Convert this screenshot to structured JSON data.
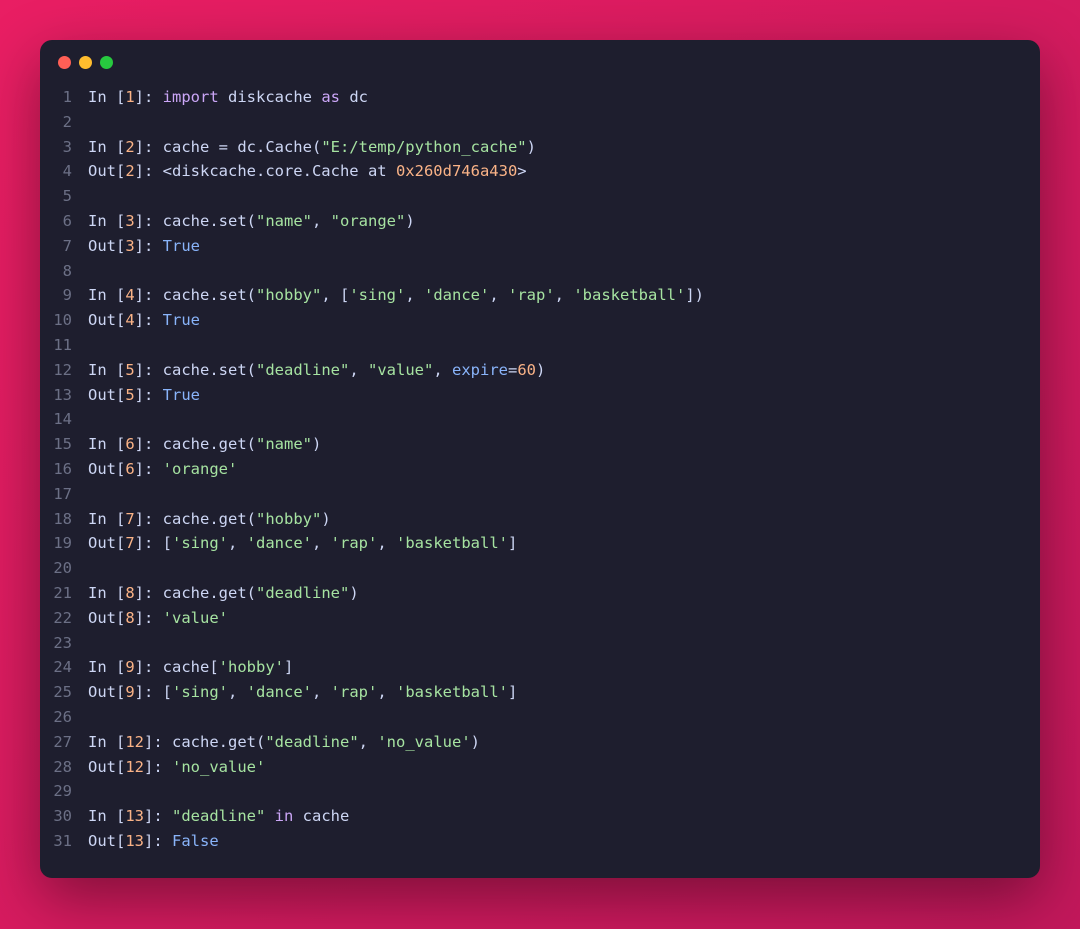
{
  "window": {
    "dots": [
      "red",
      "yellow",
      "green"
    ]
  },
  "lines": [
    {
      "n": "1",
      "tokens": [
        {
          "c": "t-default",
          "t": "In ["
        },
        {
          "c": "t-number",
          "t": "1"
        },
        {
          "c": "t-default",
          "t": "]: "
        },
        {
          "c": "t-keyword",
          "t": "import"
        },
        {
          "c": "t-default",
          "t": " diskcache "
        },
        {
          "c": "t-keyword",
          "t": "as"
        },
        {
          "c": "t-default",
          "t": " dc"
        }
      ]
    },
    {
      "n": "2",
      "tokens": []
    },
    {
      "n": "3",
      "tokens": [
        {
          "c": "t-default",
          "t": "In ["
        },
        {
          "c": "t-number",
          "t": "2"
        },
        {
          "c": "t-default",
          "t": "]: cache = dc.Cache("
        },
        {
          "c": "t-string",
          "t": "\"E:/temp/python_cache\""
        },
        {
          "c": "t-default",
          "t": ")"
        }
      ]
    },
    {
      "n": "4",
      "tokens": [
        {
          "c": "t-default",
          "t": "Out["
        },
        {
          "c": "t-number",
          "t": "2"
        },
        {
          "c": "t-default",
          "t": "]: <diskcache.core.Cache at "
        },
        {
          "c": "t-number",
          "t": "0x260d746a430"
        },
        {
          "c": "t-default",
          "t": ">"
        }
      ]
    },
    {
      "n": "5",
      "tokens": []
    },
    {
      "n": "6",
      "tokens": [
        {
          "c": "t-default",
          "t": "In ["
        },
        {
          "c": "t-number",
          "t": "3"
        },
        {
          "c": "t-default",
          "t": "]: cache.set("
        },
        {
          "c": "t-string",
          "t": "\"name\""
        },
        {
          "c": "t-default",
          "t": ", "
        },
        {
          "c": "t-string",
          "t": "\"orange\""
        },
        {
          "c": "t-default",
          "t": ")"
        }
      ]
    },
    {
      "n": "7",
      "tokens": [
        {
          "c": "t-default",
          "t": "Out["
        },
        {
          "c": "t-number",
          "t": "3"
        },
        {
          "c": "t-default",
          "t": "]: "
        },
        {
          "c": "t-bool",
          "t": "True"
        }
      ]
    },
    {
      "n": "8",
      "tokens": []
    },
    {
      "n": "9",
      "tokens": [
        {
          "c": "t-default",
          "t": "In ["
        },
        {
          "c": "t-number",
          "t": "4"
        },
        {
          "c": "t-default",
          "t": "]: cache.set("
        },
        {
          "c": "t-string",
          "t": "\"hobby\""
        },
        {
          "c": "t-default",
          "t": ", ["
        },
        {
          "c": "t-string",
          "t": "'sing'"
        },
        {
          "c": "t-default",
          "t": ", "
        },
        {
          "c": "t-string",
          "t": "'dance'"
        },
        {
          "c": "t-default",
          "t": ", "
        },
        {
          "c": "t-string",
          "t": "'rap'"
        },
        {
          "c": "t-default",
          "t": ", "
        },
        {
          "c": "t-string",
          "t": "'basketball'"
        },
        {
          "c": "t-default",
          "t": "])"
        }
      ]
    },
    {
      "n": "10",
      "tokens": [
        {
          "c": "t-default",
          "t": "Out["
        },
        {
          "c": "t-number",
          "t": "4"
        },
        {
          "c": "t-default",
          "t": "]: "
        },
        {
          "c": "t-bool",
          "t": "True"
        }
      ]
    },
    {
      "n": "11",
      "tokens": []
    },
    {
      "n": "12",
      "tokens": [
        {
          "c": "t-default",
          "t": "In ["
        },
        {
          "c": "t-number",
          "t": "5"
        },
        {
          "c": "t-default",
          "t": "]: cache.set("
        },
        {
          "c": "t-string",
          "t": "\"deadline\""
        },
        {
          "c": "t-default",
          "t": ", "
        },
        {
          "c": "t-string",
          "t": "\"value\""
        },
        {
          "c": "t-default",
          "t": ", "
        },
        {
          "c": "t-param",
          "t": "expire"
        },
        {
          "c": "t-default",
          "t": "="
        },
        {
          "c": "t-number",
          "t": "60"
        },
        {
          "c": "t-default",
          "t": ")"
        }
      ]
    },
    {
      "n": "13",
      "tokens": [
        {
          "c": "t-default",
          "t": "Out["
        },
        {
          "c": "t-number",
          "t": "5"
        },
        {
          "c": "t-default",
          "t": "]: "
        },
        {
          "c": "t-bool",
          "t": "True"
        }
      ]
    },
    {
      "n": "14",
      "tokens": []
    },
    {
      "n": "15",
      "tokens": [
        {
          "c": "t-default",
          "t": "In ["
        },
        {
          "c": "t-number",
          "t": "6"
        },
        {
          "c": "t-default",
          "t": "]: cache.get("
        },
        {
          "c": "t-string",
          "t": "\"name\""
        },
        {
          "c": "t-default",
          "t": ")"
        }
      ]
    },
    {
      "n": "16",
      "tokens": [
        {
          "c": "t-default",
          "t": "Out["
        },
        {
          "c": "t-number",
          "t": "6"
        },
        {
          "c": "t-default",
          "t": "]: "
        },
        {
          "c": "t-string",
          "t": "'orange'"
        }
      ]
    },
    {
      "n": "17",
      "tokens": []
    },
    {
      "n": "18",
      "tokens": [
        {
          "c": "t-default",
          "t": "In ["
        },
        {
          "c": "t-number",
          "t": "7"
        },
        {
          "c": "t-default",
          "t": "]: cache.get("
        },
        {
          "c": "t-string",
          "t": "\"hobby\""
        },
        {
          "c": "t-default",
          "t": ")"
        }
      ]
    },
    {
      "n": "19",
      "tokens": [
        {
          "c": "t-default",
          "t": "Out["
        },
        {
          "c": "t-number",
          "t": "7"
        },
        {
          "c": "t-default",
          "t": "]: ["
        },
        {
          "c": "t-string",
          "t": "'sing'"
        },
        {
          "c": "t-default",
          "t": ", "
        },
        {
          "c": "t-string",
          "t": "'dance'"
        },
        {
          "c": "t-default",
          "t": ", "
        },
        {
          "c": "t-string",
          "t": "'rap'"
        },
        {
          "c": "t-default",
          "t": ", "
        },
        {
          "c": "t-string",
          "t": "'basketball'"
        },
        {
          "c": "t-default",
          "t": "]"
        }
      ]
    },
    {
      "n": "20",
      "tokens": []
    },
    {
      "n": "21",
      "tokens": [
        {
          "c": "t-default",
          "t": "In ["
        },
        {
          "c": "t-number",
          "t": "8"
        },
        {
          "c": "t-default",
          "t": "]: cache.get("
        },
        {
          "c": "t-string",
          "t": "\"deadline\""
        },
        {
          "c": "t-default",
          "t": ")"
        }
      ]
    },
    {
      "n": "22",
      "tokens": [
        {
          "c": "t-default",
          "t": "Out["
        },
        {
          "c": "t-number",
          "t": "8"
        },
        {
          "c": "t-default",
          "t": "]: "
        },
        {
          "c": "t-string",
          "t": "'value'"
        }
      ]
    },
    {
      "n": "23",
      "tokens": []
    },
    {
      "n": "24",
      "tokens": [
        {
          "c": "t-default",
          "t": "In ["
        },
        {
          "c": "t-number",
          "t": "9"
        },
        {
          "c": "t-default",
          "t": "]: cache["
        },
        {
          "c": "t-string",
          "t": "'hobby'"
        },
        {
          "c": "t-default",
          "t": "]"
        }
      ]
    },
    {
      "n": "25",
      "tokens": [
        {
          "c": "t-default",
          "t": "Out["
        },
        {
          "c": "t-number",
          "t": "9"
        },
        {
          "c": "t-default",
          "t": "]: ["
        },
        {
          "c": "t-string",
          "t": "'sing'"
        },
        {
          "c": "t-default",
          "t": ", "
        },
        {
          "c": "t-string",
          "t": "'dance'"
        },
        {
          "c": "t-default",
          "t": ", "
        },
        {
          "c": "t-string",
          "t": "'rap'"
        },
        {
          "c": "t-default",
          "t": ", "
        },
        {
          "c": "t-string",
          "t": "'basketball'"
        },
        {
          "c": "t-default",
          "t": "]"
        }
      ]
    },
    {
      "n": "26",
      "tokens": []
    },
    {
      "n": "27",
      "tokens": [
        {
          "c": "t-default",
          "t": "In ["
        },
        {
          "c": "t-number",
          "t": "12"
        },
        {
          "c": "t-default",
          "t": "]: cache.get("
        },
        {
          "c": "t-string",
          "t": "\"deadline\""
        },
        {
          "c": "t-default",
          "t": ", "
        },
        {
          "c": "t-string",
          "t": "'no_value'"
        },
        {
          "c": "t-default",
          "t": ")"
        }
      ]
    },
    {
      "n": "28",
      "tokens": [
        {
          "c": "t-default",
          "t": "Out["
        },
        {
          "c": "t-number",
          "t": "12"
        },
        {
          "c": "t-default",
          "t": "]: "
        },
        {
          "c": "t-string",
          "t": "'no_value'"
        }
      ]
    },
    {
      "n": "29",
      "tokens": []
    },
    {
      "n": "30",
      "tokens": [
        {
          "c": "t-default",
          "t": "In ["
        },
        {
          "c": "t-number",
          "t": "13"
        },
        {
          "c": "t-default",
          "t": "]: "
        },
        {
          "c": "t-string",
          "t": "\"deadline\""
        },
        {
          "c": "t-default",
          "t": " "
        },
        {
          "c": "t-keyword",
          "t": "in"
        },
        {
          "c": "t-default",
          "t": " cache"
        }
      ]
    },
    {
      "n": "31",
      "tokens": [
        {
          "c": "t-default",
          "t": "Out["
        },
        {
          "c": "t-number",
          "t": "13"
        },
        {
          "c": "t-default",
          "t": "]: "
        },
        {
          "c": "t-bool",
          "t": "False"
        }
      ]
    }
  ]
}
